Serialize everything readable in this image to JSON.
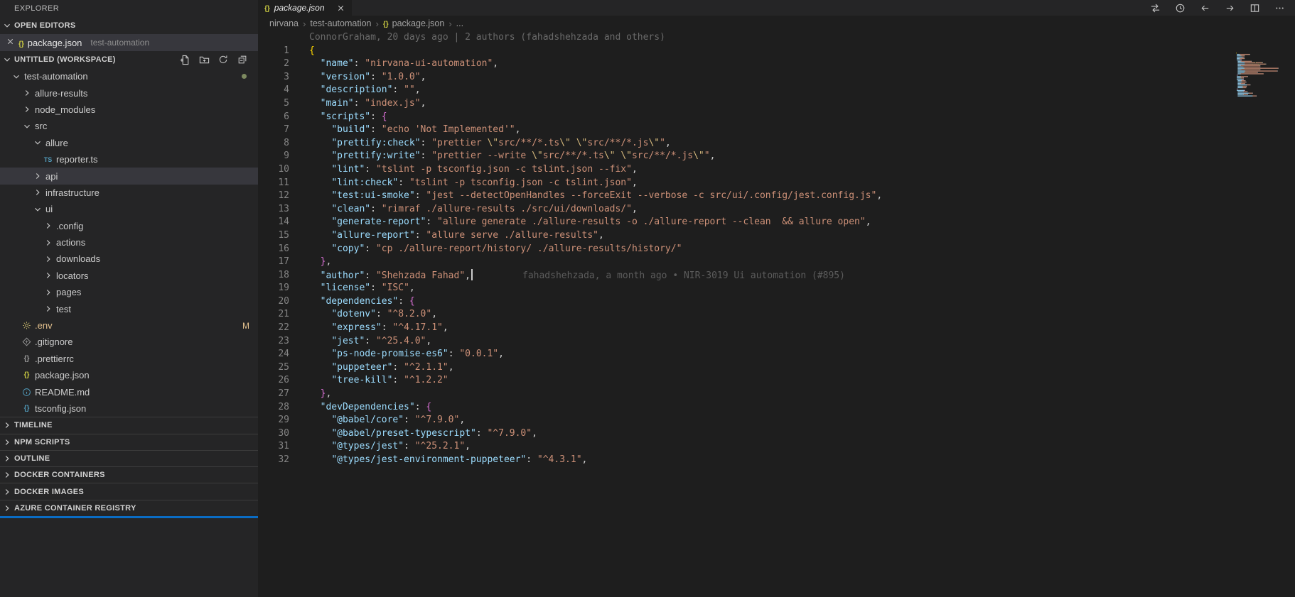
{
  "colors": {
    "editor_bg": "#1e1e1e",
    "sidebar_bg": "#252526",
    "selection_bg": "#37373d",
    "accent_blue": "#0a6cc4",
    "token_key": "#9cdcfe",
    "token_string": "#ce9178",
    "token_punct": "#d4d4d4",
    "token_brace_outer": "#ffd700",
    "token_brace_inner": "#da70d6",
    "token_escape": "#d7ba7d",
    "line_number": "#858585",
    "blame_text": "#6a6a6a",
    "git_modified": "#e2c08d"
  },
  "sidebar": {
    "title": "EXPLORER",
    "open_editors": {
      "title": "OPEN EDITORS",
      "items": [
        {
          "name": "package.json",
          "detail": "test-automation",
          "icon": "json-yellow-icon",
          "active": true
        }
      ]
    },
    "workspace": {
      "title": "UNTITLED (WORKSPACE)",
      "actions": [
        "new-file-icon",
        "new-folder-icon",
        "refresh-explorer-icon",
        "collapse-folders-icon"
      ]
    },
    "tree": [
      {
        "label": "test-automation",
        "kind": "folder",
        "expanded": true,
        "level": 0,
        "dot": true
      },
      {
        "label": "allure-results",
        "kind": "folder",
        "expanded": false,
        "level": 1
      },
      {
        "label": "node_modules",
        "kind": "folder",
        "expanded": false,
        "level": 1
      },
      {
        "label": "src",
        "kind": "folder",
        "expanded": true,
        "level": 1
      },
      {
        "label": "allure",
        "kind": "folder",
        "expanded": true,
        "level": 2
      },
      {
        "label": "reporter.ts",
        "kind": "file",
        "icon": "ts-icon",
        "level": 3
      },
      {
        "label": "api",
        "kind": "folder",
        "expanded": false,
        "level": 2,
        "selected": true
      },
      {
        "label": "infrastructure",
        "kind": "folder",
        "expanded": false,
        "level": 2
      },
      {
        "label": "ui",
        "kind": "folder",
        "expanded": true,
        "level": 2
      },
      {
        "label": ".config",
        "kind": "folder",
        "expanded": false,
        "level": 3
      },
      {
        "label": "actions",
        "kind": "folder",
        "expanded": false,
        "level": 3
      },
      {
        "label": "downloads",
        "kind": "folder",
        "expanded": false,
        "level": 3
      },
      {
        "label": "locators",
        "kind": "folder",
        "expanded": false,
        "level": 3
      },
      {
        "label": "pages",
        "kind": "folder",
        "expanded": false,
        "level": 3
      },
      {
        "label": "test",
        "kind": "folder",
        "expanded": false,
        "level": 3
      },
      {
        "label": ".env",
        "kind": "file",
        "icon": "gear-icon",
        "level": 1,
        "badge": "M",
        "modified": true
      },
      {
        "label": ".gitignore",
        "kind": "file",
        "icon": "git-icon",
        "level": 1
      },
      {
        "label": ".prettierrc",
        "kind": "file",
        "icon": "json-gray-icon",
        "level": 1
      },
      {
        "label": "package.json",
        "kind": "file",
        "icon": "json-yellow-icon",
        "level": 1
      },
      {
        "label": "README.md",
        "kind": "file",
        "icon": "info-icon",
        "level": 1
      },
      {
        "label": "tsconfig.json",
        "kind": "file",
        "icon": "json-blue-icon",
        "level": 1
      }
    ],
    "panels": [
      "TIMELINE",
      "NPM SCRIPTS",
      "OUTLINE",
      "DOCKER CONTAINERS",
      "DOCKER IMAGES",
      "AZURE CONTAINER REGISTRY"
    ]
  },
  "editor": {
    "tab": {
      "label": "package.json",
      "icon": "json-yellow-icon"
    },
    "actions": [
      "open-changes-icon",
      "history-icon",
      "back-icon",
      "forward-icon",
      "split-editor-icon",
      "more-actions-icon"
    ],
    "breadcrumbs": [
      {
        "label": "nirvana"
      },
      {
        "label": "test-automation"
      },
      {
        "label": "package.json",
        "icon": "json-yellow-icon"
      },
      {
        "label": "..."
      }
    ],
    "blame_header": "ConnorGraham, 20 days ago | 2 authors (fahadshehzada and others)",
    "lines": [
      {
        "t": [
          [
            "b1",
            "{"
          ]
        ]
      },
      {
        "t": [
          [
            "p",
            "  "
          ],
          [
            "k",
            "\"name\""
          ],
          [
            "p",
            ": "
          ],
          [
            "s",
            "\"nirvana-ui-automation\""
          ],
          [
            "p",
            ","
          ]
        ]
      },
      {
        "t": [
          [
            "p",
            "  "
          ],
          [
            "k",
            "\"version\""
          ],
          [
            "p",
            ": "
          ],
          [
            "s",
            "\"1.0.0\""
          ],
          [
            "p",
            ","
          ]
        ]
      },
      {
        "t": [
          [
            "p",
            "  "
          ],
          [
            "k",
            "\"description\""
          ],
          [
            "p",
            ": "
          ],
          [
            "s",
            "\"\""
          ],
          [
            "p",
            ","
          ]
        ]
      },
      {
        "t": [
          [
            "p",
            "  "
          ],
          [
            "k",
            "\"main\""
          ],
          [
            "p",
            ": "
          ],
          [
            "s",
            "\"index.js\""
          ],
          [
            "p",
            ","
          ]
        ]
      },
      {
        "t": [
          [
            "p",
            "  "
          ],
          [
            "k",
            "\"scripts\""
          ],
          [
            "p",
            ": "
          ],
          [
            "b2",
            "{"
          ]
        ]
      },
      {
        "t": [
          [
            "p",
            "    "
          ],
          [
            "k",
            "\"build\""
          ],
          [
            "p",
            ": "
          ],
          [
            "s",
            "\"echo 'Not Implemented'\""
          ],
          [
            "p",
            ","
          ]
        ]
      },
      {
        "t": [
          [
            "p",
            "    "
          ],
          [
            "k",
            "\"prettify:check\""
          ],
          [
            "p",
            ": "
          ],
          [
            "s",
            "\"prettier "
          ],
          [
            "e",
            "\\\""
          ],
          [
            "s",
            "src/**/*.ts"
          ],
          [
            "e",
            "\\\""
          ],
          [
            "s",
            " "
          ],
          [
            "e",
            "\\\""
          ],
          [
            "s",
            "src/**/*.js"
          ],
          [
            "e",
            "\\\""
          ],
          [
            "s",
            "\""
          ],
          [
            "p",
            ","
          ]
        ]
      },
      {
        "t": [
          [
            "p",
            "    "
          ],
          [
            "k",
            "\"prettify:write\""
          ],
          [
            "p",
            ": "
          ],
          [
            "s",
            "\"prettier --write "
          ],
          [
            "e",
            "\\\""
          ],
          [
            "s",
            "src/**/*.ts"
          ],
          [
            "e",
            "\\\""
          ],
          [
            "s",
            " "
          ],
          [
            "e",
            "\\\""
          ],
          [
            "s",
            "src/**/*.js"
          ],
          [
            "e",
            "\\\""
          ],
          [
            "s",
            "\""
          ],
          [
            "p",
            ","
          ]
        ]
      },
      {
        "t": [
          [
            "p",
            "    "
          ],
          [
            "k",
            "\"lint\""
          ],
          [
            "p",
            ": "
          ],
          [
            "s",
            "\"tslint -p tsconfig.json -c tslint.json --fix\""
          ],
          [
            "p",
            ","
          ]
        ]
      },
      {
        "t": [
          [
            "p",
            "    "
          ],
          [
            "k",
            "\"lint:check\""
          ],
          [
            "p",
            ": "
          ],
          [
            "s",
            "\"tslint -p tsconfig.json -c tslint.json\""
          ],
          [
            "p",
            ","
          ]
        ]
      },
      {
        "t": [
          [
            "p",
            "    "
          ],
          [
            "k",
            "\"test:ui-smoke\""
          ],
          [
            "p",
            ": "
          ],
          [
            "s",
            "\"jest --detectOpenHandles --forceExit --verbose -c src/ui/.config/jest.config.js\""
          ],
          [
            "p",
            ","
          ]
        ]
      },
      {
        "t": [
          [
            "p",
            "    "
          ],
          [
            "k",
            "\"clean\""
          ],
          [
            "p",
            ": "
          ],
          [
            "s",
            "\"rimraf ./allure-results ./src/ui/downloads/\""
          ],
          [
            "p",
            ","
          ]
        ]
      },
      {
        "t": [
          [
            "p",
            "    "
          ],
          [
            "k",
            "\"generate-report\""
          ],
          [
            "p",
            ": "
          ],
          [
            "s",
            "\"allure generate ./allure-results -o ./allure-report --clean  && allure open\""
          ],
          [
            "p",
            ","
          ]
        ]
      },
      {
        "t": [
          [
            "p",
            "    "
          ],
          [
            "k",
            "\"allure-report\""
          ],
          [
            "p",
            ": "
          ],
          [
            "s",
            "\"allure serve ./allure-results\""
          ],
          [
            "p",
            ","
          ]
        ]
      },
      {
        "t": [
          [
            "p",
            "    "
          ],
          [
            "k",
            "\"copy\""
          ],
          [
            "p",
            ": "
          ],
          [
            "s",
            "\"cp ./allure-report/history/ ./allure-results/history/\""
          ]
        ]
      },
      {
        "t": [
          [
            "p",
            "  "
          ],
          [
            "b2",
            "}"
          ],
          [
            "p",
            ","
          ]
        ]
      },
      {
        "t": [
          [
            "p",
            "  "
          ],
          [
            "k",
            "\"author\""
          ],
          [
            "p",
            ": "
          ],
          [
            "s",
            "\"Shehzada Fahad\""
          ],
          [
            "p",
            ","
          ]
        ],
        "cursor": true,
        "blame": "fahadshehzada, a month ago • NIR-3019 Ui automation (#895)"
      },
      {
        "t": [
          [
            "p",
            "  "
          ],
          [
            "k",
            "\"license\""
          ],
          [
            "p",
            ": "
          ],
          [
            "s",
            "\"ISC\""
          ],
          [
            "p",
            ","
          ]
        ]
      },
      {
        "t": [
          [
            "p",
            "  "
          ],
          [
            "k",
            "\"dependencies\""
          ],
          [
            "p",
            ": "
          ],
          [
            "b2",
            "{"
          ]
        ]
      },
      {
        "t": [
          [
            "p",
            "    "
          ],
          [
            "k",
            "\"dotenv\""
          ],
          [
            "p",
            ": "
          ],
          [
            "s",
            "\"^8.2.0\""
          ],
          [
            "p",
            ","
          ]
        ]
      },
      {
        "t": [
          [
            "p",
            "    "
          ],
          [
            "k",
            "\"express\""
          ],
          [
            "p",
            ": "
          ],
          [
            "s",
            "\"^4.17.1\""
          ],
          [
            "p",
            ","
          ]
        ]
      },
      {
        "t": [
          [
            "p",
            "    "
          ],
          [
            "k",
            "\"jest\""
          ],
          [
            "p",
            ": "
          ],
          [
            "s",
            "\"^25.4.0\""
          ],
          [
            "p",
            ","
          ]
        ]
      },
      {
        "t": [
          [
            "p",
            "    "
          ],
          [
            "k",
            "\"ps-node-promise-es6\""
          ],
          [
            "p",
            ": "
          ],
          [
            "s",
            "\"0.0.1\""
          ],
          [
            "p",
            ","
          ]
        ]
      },
      {
        "t": [
          [
            "p",
            "    "
          ],
          [
            "k",
            "\"puppeteer\""
          ],
          [
            "p",
            ": "
          ],
          [
            "s",
            "\"^2.1.1\""
          ],
          [
            "p",
            ","
          ]
        ]
      },
      {
        "t": [
          [
            "p",
            "    "
          ],
          [
            "k",
            "\"tree-kill\""
          ],
          [
            "p",
            ": "
          ],
          [
            "s",
            "\"^1.2.2\""
          ]
        ]
      },
      {
        "t": [
          [
            "p",
            "  "
          ],
          [
            "b2",
            "}"
          ],
          [
            "p",
            ","
          ]
        ]
      },
      {
        "t": [
          [
            "p",
            "  "
          ],
          [
            "k",
            "\"devDependencies\""
          ],
          [
            "p",
            ": "
          ],
          [
            "b2",
            "{"
          ]
        ]
      },
      {
        "t": [
          [
            "p",
            "    "
          ],
          [
            "k",
            "\"@babel/core\""
          ],
          [
            "p",
            ": "
          ],
          [
            "s",
            "\"^7.9.0\""
          ],
          [
            "p",
            ","
          ]
        ]
      },
      {
        "t": [
          [
            "p",
            "    "
          ],
          [
            "k",
            "\"@babel/preset-typescript\""
          ],
          [
            "p",
            ": "
          ],
          [
            "s",
            "\"^7.9.0\""
          ],
          [
            "p",
            ","
          ]
        ]
      },
      {
        "t": [
          [
            "p",
            "    "
          ],
          [
            "k",
            "\"@types/jest\""
          ],
          [
            "p",
            ": "
          ],
          [
            "s",
            "\"^25.2.1\""
          ],
          [
            "p",
            ","
          ]
        ]
      },
      {
        "t": [
          [
            "p",
            "    "
          ],
          [
            "k",
            "\"@types/jest-environment-puppeteer\""
          ],
          [
            "p",
            ": "
          ],
          [
            "s",
            "\"^4.3.1\""
          ],
          [
            "p",
            ","
          ]
        ]
      }
    ]
  }
}
